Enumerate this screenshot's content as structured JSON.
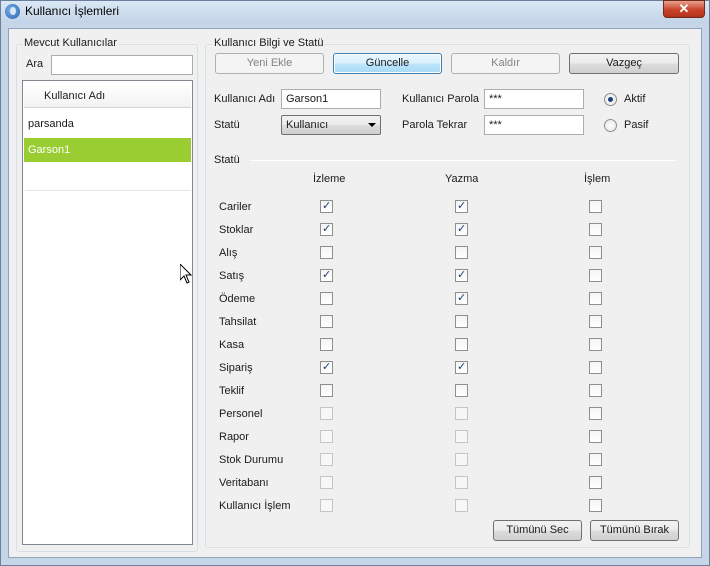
{
  "window": {
    "title": "Kullanıcı İşlemleri",
    "close_label": "✕"
  },
  "left_panel": {
    "legend": "Mevcut Kullanıcılar",
    "search_label": "Ara",
    "search_value": "",
    "list_header": "Kullanıcı Adı",
    "users": [
      {
        "name": "parsanda",
        "selected": false
      },
      {
        "name": "Garson1",
        "selected": true
      }
    ]
  },
  "right_panel": {
    "legend": "Kullanıcı Bilgi ve Statü",
    "buttons": {
      "new": "Yeni Ekle",
      "update": "Güncelle",
      "remove": "Kaldır",
      "cancel": "Vazgeç"
    },
    "form": {
      "username_label": "Kullanıcı Adı",
      "username_value": "Garson1",
      "password_label": "Kullanıcı Parola",
      "password_value": "***",
      "status_label": "Statü",
      "status_value": "Kullanıcı",
      "password_repeat_label": "Parola Tekrar",
      "password_repeat_value": "***",
      "active_label": "Aktif",
      "passive_label": "Pasif",
      "active_selected": true
    },
    "permissions": {
      "section_label": "Statü",
      "columns": [
        "İzleme",
        "Yazma",
        "İşlem"
      ],
      "rows": [
        {
          "label": "Cariler",
          "izleme": true,
          "yazma": true,
          "islem": false
        },
        {
          "label": "Stoklar",
          "izleme": true,
          "yazma": true,
          "islem": false
        },
        {
          "label": "Alış",
          "izleme": false,
          "yazma": false,
          "islem": false
        },
        {
          "label": "Satış",
          "izleme": true,
          "yazma": true,
          "islem": false
        },
        {
          "label": "Ödeme",
          "izleme": false,
          "yazma": true,
          "islem": false
        },
        {
          "label": "Tahsilat",
          "izleme": false,
          "yazma": false,
          "islem": false
        },
        {
          "label": "Kasa",
          "izleme": false,
          "yazma": false,
          "islem": false
        },
        {
          "label": "Sipariş",
          "izleme": true,
          "yazma": true,
          "islem": false
        },
        {
          "label": "Teklif",
          "izleme": false,
          "yazma": false,
          "islem": false
        },
        {
          "label": "Personel",
          "izleme": false,
          "yazma": false,
          "islem": false
        },
        {
          "label": "Rapor",
          "izleme": false,
          "yazma": false,
          "islem": false
        },
        {
          "label": "Stok Durumu",
          "izleme": false,
          "yazma": false,
          "islem": false
        },
        {
          "label": "Veritabanı",
          "izleme": false,
          "yazma": false,
          "islem": false
        },
        {
          "label": "Kullanıcı İşlem",
          "izleme": false,
          "yazma": false,
          "islem": false
        }
      ],
      "select_all_label": "Tümünü Sec",
      "clear_all_label": "Tümünü Bırak"
    }
  }
}
